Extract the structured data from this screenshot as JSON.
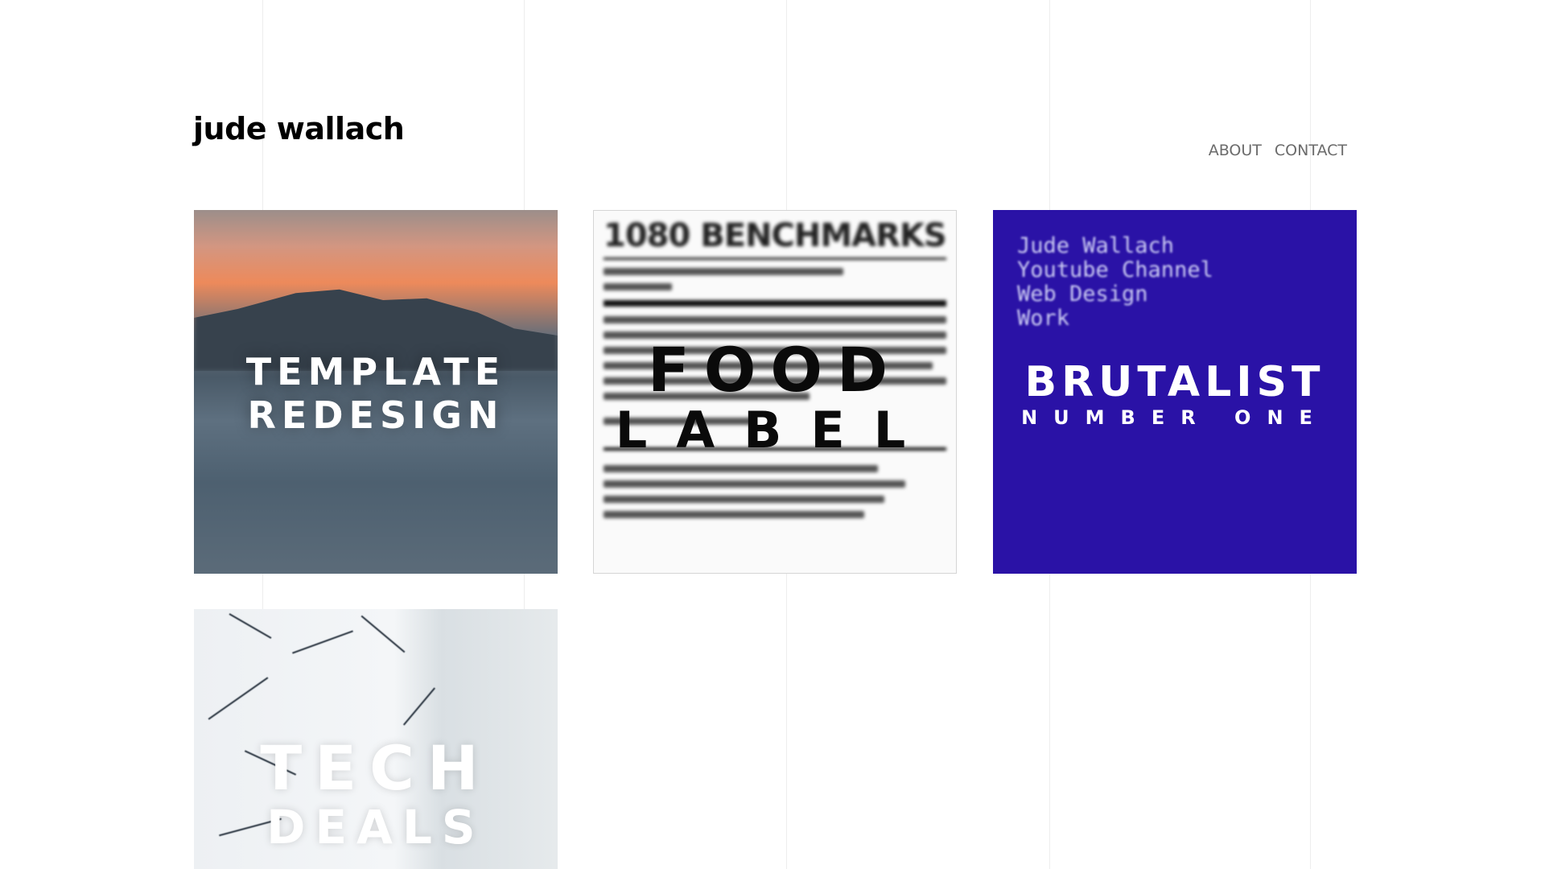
{
  "site": {
    "title": "jude wallach"
  },
  "nav": {
    "items": [
      {
        "label": "ABOUT"
      },
      {
        "label": "CONTACT"
      }
    ]
  },
  "tiles": [
    {
      "line1": "TEMPLATE",
      "line2": "REDESIGN",
      "background": "#5b6b79"
    },
    {
      "line1": "FOOD",
      "line2": "LABEL",
      "doc_heading": "1080 BENCHMARKS",
      "background": "#fafafa"
    },
    {
      "line1": "BRUTALIST",
      "line2": "NUMBER ONE",
      "mono_lines": [
        "Jude Wallach",
        "Youtube Channel",
        "Web Design",
        "Work"
      ],
      "background": "#2a12a6"
    },
    {
      "line1": "TECH",
      "line2": "DEALS",
      "background": "#edf0f3"
    }
  ]
}
